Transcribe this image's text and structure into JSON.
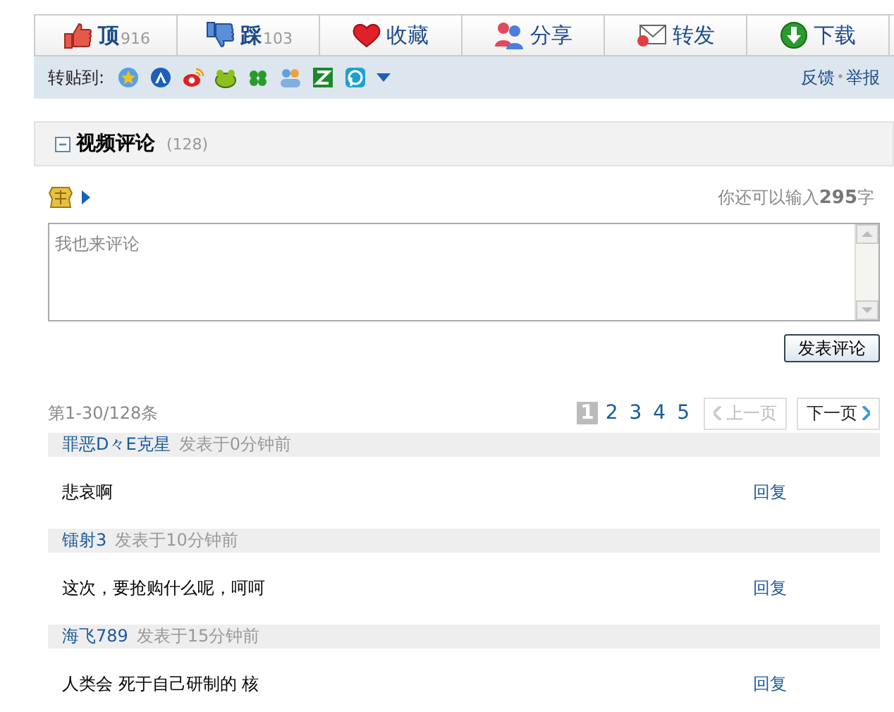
{
  "actions": [
    {
      "kind": "like",
      "label": "顶",
      "count": "916"
    },
    {
      "kind": "dislike",
      "label": "踩",
      "count": "103"
    },
    {
      "kind": "favorite",
      "label": "收藏"
    },
    {
      "kind": "share",
      "label": "分享"
    },
    {
      "kind": "forward",
      "label": "转发"
    },
    {
      "kind": "download",
      "label": "下载"
    }
  ],
  "share_bar": {
    "label": "转贴到:",
    "links": [
      "反馈",
      "举报"
    ]
  },
  "section": {
    "title": "视频评论",
    "count": "(128)",
    "expanded": true
  },
  "composer": {
    "remaining_prefix": "你还可以输入",
    "remaining": "295",
    "remaining_suffix": "字",
    "placeholder": "我也来评论",
    "submit": "发表评论"
  },
  "pagination": {
    "summary": "第1-30/128条",
    "pages": [
      {
        "label": "1",
        "selected": true
      },
      {
        "label": "2",
        "selected": false
      },
      {
        "label": "3",
        "selected": false
      },
      {
        "label": "4",
        "selected": false
      },
      {
        "label": "5",
        "selected": false
      }
    ],
    "prev": {
      "label": "上一页",
      "disabled": true
    },
    "next": {
      "label": "下一页",
      "disabled": false
    }
  },
  "comments": [
    {
      "user": "罪恶D々E克星",
      "time": "发表于0分钟前",
      "text": "悲哀啊",
      "reply": "回复"
    },
    {
      "user": "镭射3",
      "time": "发表于10分钟前",
      "text": "这次，要抢购什么呢，呵呵",
      "reply": "回复"
    },
    {
      "user": "海飞789",
      "time": "发表于15分钟前",
      "text": "人类会 死于自己研制的 核",
      "reply": "回复"
    }
  ]
}
